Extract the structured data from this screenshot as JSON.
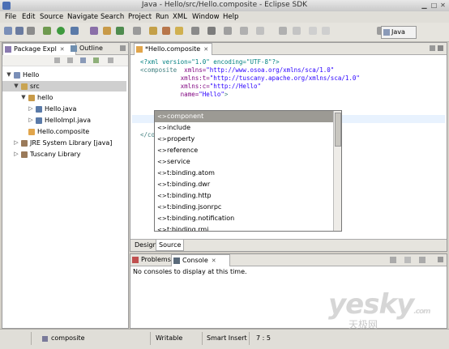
{
  "window": {
    "title": "Java - Hello/src/Hello.composite - Eclipse SDK"
  },
  "menu": [
    "File",
    "Edit",
    "Source",
    "Navigate",
    "Search",
    "Project",
    "Run",
    "XML",
    "Window",
    "Help"
  ],
  "perspective": {
    "label": "Java"
  },
  "package_explorer": {
    "tabs": [
      "Package Expl",
      "Outline"
    ],
    "tree": [
      {
        "label": "Hello",
        "level": 0,
        "expanded": true,
        "icon": "project-icon"
      },
      {
        "label": "src",
        "level": 1,
        "expanded": true,
        "icon": "source-folder-icon",
        "selected": true
      },
      {
        "label": "hello",
        "level": 2,
        "expanded": true,
        "icon": "package-icon"
      },
      {
        "label": "Hello.java",
        "level": 3,
        "expanded": false,
        "icon": "java-file-icon"
      },
      {
        "label": "HelloImpl.java",
        "level": 3,
        "expanded": false,
        "icon": "java-file-icon"
      },
      {
        "label": "Hello.composite",
        "level": 2,
        "icon": "xml-file-icon"
      },
      {
        "label": "JRE System Library [java]",
        "level": 1,
        "expanded": false,
        "icon": "library-icon"
      },
      {
        "label": "Tuscany Library",
        "level": 1,
        "expanded": false,
        "icon": "library-icon"
      }
    ]
  },
  "editor": {
    "tab": "*Hello.composite",
    "lines": [
      [
        {
          "t": "<?xml version=\"1.0\" encoding=\"UTF-8\"?>",
          "c": "pi"
        }
      ],
      [
        {
          "t": "<composite",
          "c": "tag"
        },
        {
          "t": "  xmlns=",
          "c": "attr"
        },
        {
          "t": "\"http://www.osoa.org/xmlns/sca/1.0\"",
          "c": "val"
        }
      ],
      [
        {
          "t": "           xmlns:t=",
          "c": "attr"
        },
        {
          "t": "\"http://tuscany.apache.org/xmlns/sca/1.0\"",
          "c": "val"
        }
      ],
      [
        {
          "t": "           xmlns:c=",
          "c": "attr"
        },
        {
          "t": "\"http://Hello\"",
          "c": "val"
        }
      ],
      [
        {
          "t": "           name=",
          "c": "attr"
        },
        {
          "t": "\"Hello\"",
          "c": "val"
        },
        {
          "t": ">",
          "c": "tag"
        }
      ],
      [],
      [],
      [],
      [],
      [
        {
          "t": "</co",
          "c": "tag"
        }
      ]
    ],
    "bottom_tabs": [
      "Design",
      "Source"
    ],
    "active_bottom_tab": "Source"
  },
  "content_assist": {
    "items": [
      "component",
      "include",
      "property",
      "reference",
      "service",
      "t:binding.atom",
      "t:binding.dwr",
      "t:binding.http",
      "t:binding.jsonrpc",
      "t:binding.notification",
      "t:binding.rmi"
    ],
    "selected_index": 0
  },
  "console": {
    "tabs": [
      "Problems",
      "Console"
    ],
    "active_tab": "Console",
    "message": "No consoles to display at this time."
  },
  "statusbar": {
    "element": "composite",
    "mode": "Writable",
    "insert": "Smart Insert",
    "position": "7 : 5"
  },
  "watermark": {
    "main": "yesky",
    "com": ".com",
    "sub": "天极网"
  }
}
